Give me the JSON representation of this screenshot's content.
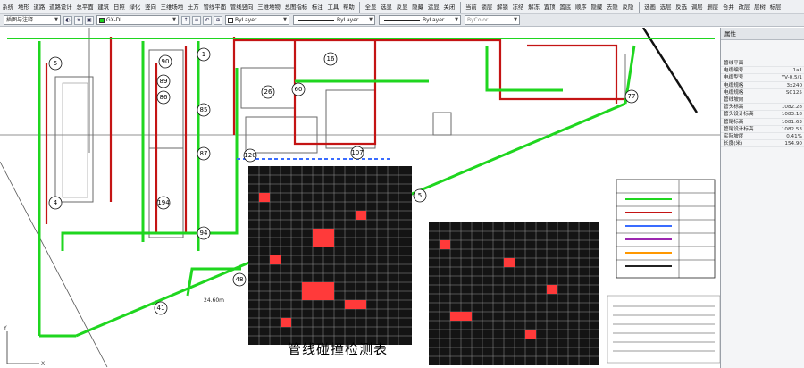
{
  "menu": {
    "main": [
      "系统",
      "地形",
      "道路",
      "道路设计",
      "总平面",
      "建筑",
      "日照",
      "绿化",
      "竖向",
      "三维场地",
      "土方",
      "管线平面",
      "管线竖向",
      "三维地物",
      "总图指标",
      "标注",
      "工具",
      "帮助"
    ],
    "edit": [
      "全显",
      "选显",
      "反显",
      "隐藏",
      "运显",
      "关闭"
    ],
    "ops": [
      "当前",
      "锁层",
      "解锁",
      "冻结",
      "解冻",
      "置顶",
      "置底",
      "顺序",
      "隐藏",
      "去隐",
      "反隐"
    ],
    "view": [
      "选画",
      "选层",
      "反选",
      "调层",
      "删层",
      "合并",
      "改层",
      "层树",
      "标层"
    ]
  },
  "toolbar": {
    "style_combo": "插图与注释",
    "layer_combo": "GX-DL",
    "color_combo": "ByLayer",
    "linetype_combo": "ByLayer",
    "lineweight_combo": "ByLayer",
    "plotstyle_combo": "ByColor"
  },
  "drawing": {
    "title": "管线碰撞检测表",
    "pipe_labels": [
      "90",
      "1",
      "89",
      "86",
      "85",
      "87",
      "194",
      "41",
      "48",
      "26",
      "60",
      "16",
      "120",
      "77",
      "5",
      "4",
      "94",
      "107",
      "5"
    ],
    "annotation": "24.60m"
  },
  "properties": {
    "header": "属性",
    "rows": [
      {
        "key": "管线平面",
        "value": ""
      },
      {
        "key": "电缆编号",
        "value": "1a1"
      },
      {
        "key": "电缆型号",
        "value": "YV-0.5/1"
      },
      {
        "key": "电缆规格",
        "value": "3x240"
      },
      {
        "key": "电缆规格",
        "value": "SC125"
      },
      {
        "key": "管线坡向",
        "value": ""
      },
      {
        "key": "管头标高",
        "value": "1082.28"
      },
      {
        "key": "管头设计标高",
        "value": "1083.18"
      },
      {
        "key": "管尾标高",
        "value": "1081.63"
      },
      {
        "key": "管尾设计标高",
        "value": "1082.53"
      },
      {
        "key": "实际坡度",
        "value": "0.41%"
      },
      {
        "key": "长度(米)",
        "value": "154.90"
      }
    ]
  },
  "colors": {
    "pipe_green": "#1fd61f",
    "pipe_red": "#c41414",
    "building_gray": "#7d7d7d",
    "conflict_red": "#ff3a3a"
  }
}
